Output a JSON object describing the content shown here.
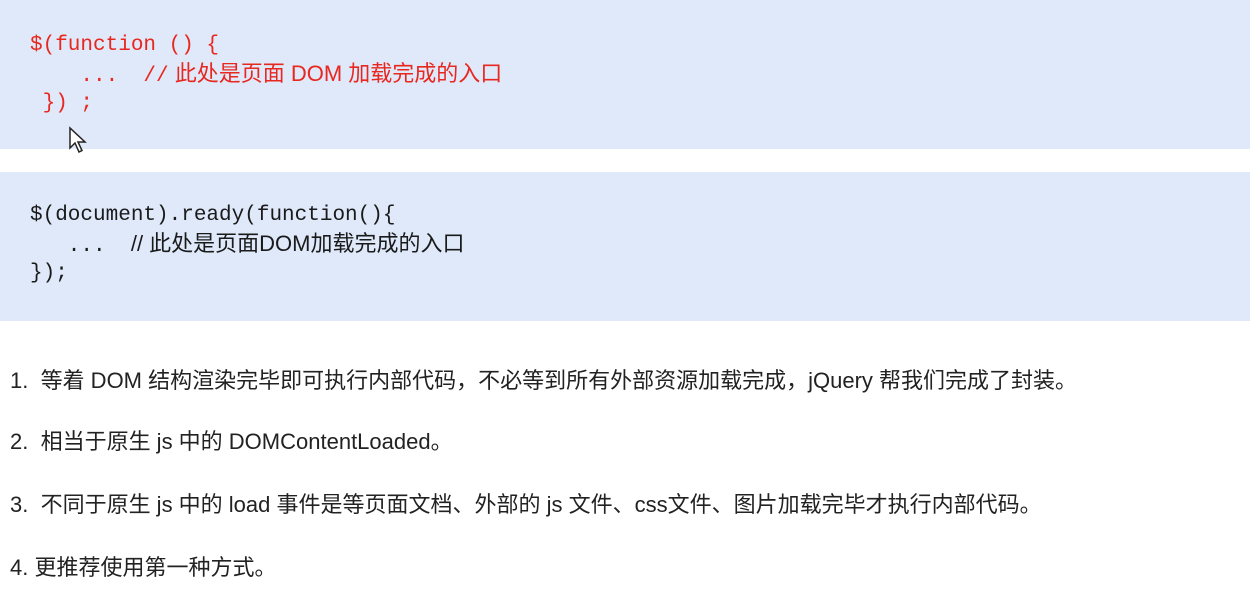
{
  "code_blocks": [
    {
      "lines": {
        "l1": "$(function () {",
        "l2_code": "    ...  //",
        "l2_comment": " 此处是页面 DOM 加载完成的入口",
        "l3": " }) ;"
      }
    },
    {
      "lines": {
        "l1": "$(document).ready(function(){",
        "l2_code": "   ...  ",
        "l2_comment": "// 此处是页面DOM加载完成的入口",
        "l3": "});"
      }
    }
  ],
  "notes": [
    "1.  等着 DOM 结构渲染完毕即可执行内部代码，不必等到所有外部资源加载完成，jQuery 帮我们完成了封装。",
    "2.  相当于原生 js 中的 DOMContentLoaded。",
    "3.  不同于原生 js 中的 load 事件是等页面文档、外部的 js 文件、css文件、图片加载完毕才执行内部代码。",
    "4. 更推荐使用第一种方式。"
  ],
  "colors": {
    "code_bg": "#dfe9fa",
    "highlight": "#e8271f"
  },
  "icons": {
    "cursor": "mouse-pointer-icon"
  }
}
